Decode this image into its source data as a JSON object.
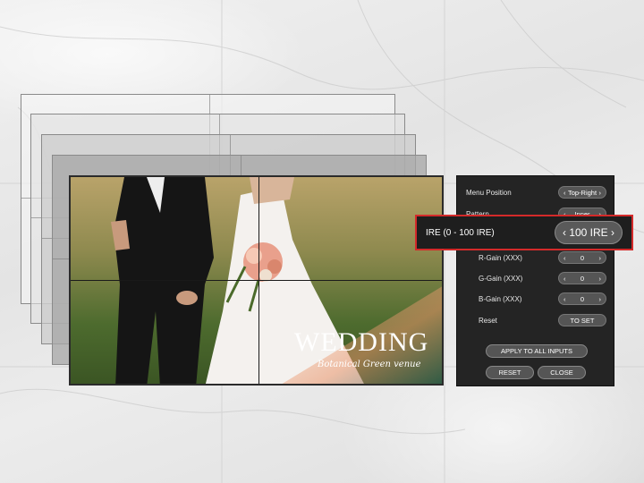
{
  "screen": {
    "title": "WEDDING",
    "subtitle": "Botanical Green venue"
  },
  "menu": {
    "rows": [
      {
        "label": "Menu Position",
        "value": "Top-Right"
      },
      {
        "label": "Pattern",
        "value": "Inner"
      },
      {
        "label": "R-Gain (XXX)",
        "value": "0"
      },
      {
        "label": "G-Gain (XXX)",
        "value": "0"
      },
      {
        "label": "B-Gain (XXX)",
        "value": "0"
      },
      {
        "label": "Reset",
        "value": "TO SET"
      }
    ],
    "highlight": {
      "label": "IRE (0 - 100 IRE)",
      "value": "100 IRE"
    },
    "buttons": {
      "apply_all": "APPLY TO ALL INPUTS",
      "reset": "RESET",
      "close": "CLOSE"
    },
    "arrow_left": "‹",
    "arrow_right": "›"
  },
  "colors": {
    "highlight_border": "#d42a2a",
    "panel_bg": "#242424"
  }
}
